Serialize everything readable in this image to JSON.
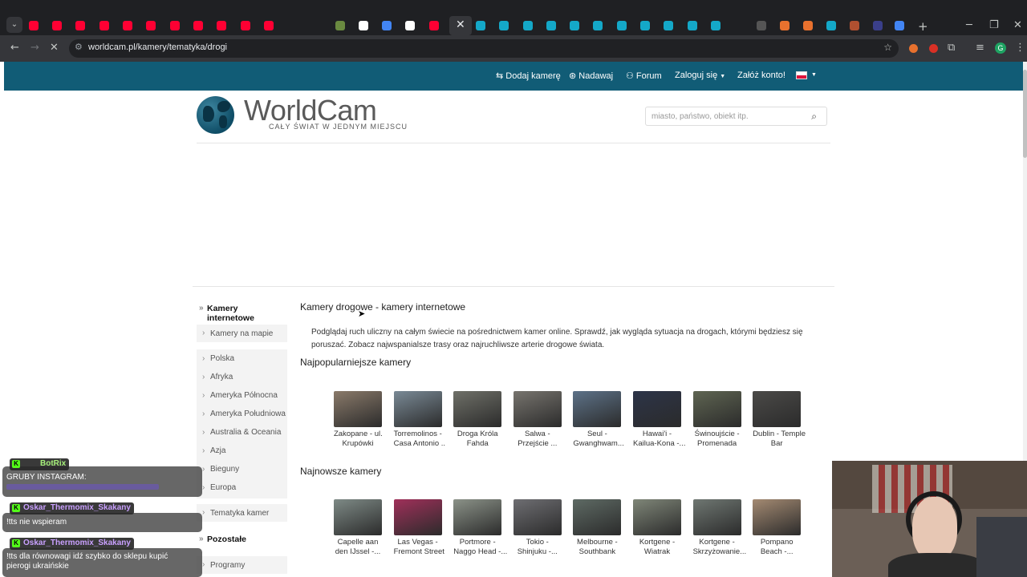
{
  "browser": {
    "url": "worldcam.pl/kamery/tematyka/drogi"
  },
  "nav": {
    "items": [
      {
        "label": "Dodaj kamerę"
      },
      {
        "label": "Nadawaj"
      },
      {
        "label": "Forum"
      },
      {
        "label": "Zaloguj się"
      },
      {
        "label": "Załóż konto!"
      }
    ]
  },
  "header": {
    "logo_text": "WorldCam",
    "logo_tagline": "CAŁY ŚWIAT W JEDNYM MIEJSCU",
    "search_placeholder": "miasto, państwo, obiekt itp."
  },
  "sidebar": {
    "items": [
      {
        "label": "Kamery internetowe"
      },
      {
        "label": "Kamery na mapie"
      },
      {
        "label": "Polska"
      },
      {
        "label": "Afryka"
      },
      {
        "label": "Ameryka Północna"
      },
      {
        "label": "Ameryka Południowa"
      },
      {
        "label": "Australia & Oceania"
      },
      {
        "label": "Azja"
      },
      {
        "label": "Bieguny"
      },
      {
        "label": "Europa"
      },
      {
        "label": "Tematyka kamer"
      },
      {
        "label": "Pozostałe"
      },
      {
        "label": "Programy"
      }
    ]
  },
  "main": {
    "title": "Kamery drogowe - kamery internetowe",
    "intro": "Podglądaj ruch uliczny na całym świecie na pośrednictwem kamer online. Sprawdź, jak wygląda sytuacja na drogach, którymi będziesz się poruszać. Zobacz najwspanialsze trasy oraz najruchliwsze arterie drogowe świata.",
    "popular_heading": "Najpopularniejsze kamery",
    "popular": [
      {
        "line1": "Zakopane - ul.",
        "line2": "Krupówki",
        "color": "#8a7a6a"
      },
      {
        "line1": "Torremolinos -",
        "line2": "Casa Antonio ..",
        "color": "#7a8a96"
      },
      {
        "line1": "Droga Króla",
        "line2": "Fahda",
        "color": "#6f7068"
      },
      {
        "line1": "Salwa -",
        "line2": "Przejście ...",
        "color": "#77746e"
      },
      {
        "line1": "Seul -",
        "line2": "Gwanghwam...",
        "color": "#5d7288"
      },
      {
        "line1": "Hawai'i -",
        "line2": "Kailua-Kona -...",
        "color": "#2c3448"
      },
      {
        "line1": "Świnoujście -",
        "line2": "Promenada",
        "color": "#5f6552"
      },
      {
        "line1": "Dublin - Temple",
        "line2": "Bar",
        "color": "#4b4a48"
      }
    ],
    "newest_heading": "Najnowsze kamery",
    "newest": [
      {
        "line1": "Capelle aan",
        "line2": "den IJssel -...",
        "color": "#7e8a86"
      },
      {
        "line1": "Las Vegas -",
        "line2": "Fremont Street",
        "color": "#a0305a"
      },
      {
        "line1": "Portmore -",
        "line2": "Naggo Head -...",
        "color": "#8b9288"
      },
      {
        "line1": "Tokio -",
        "line2": "Shinjuku -...",
        "color": "#6e6e72"
      },
      {
        "line1": "Melbourne -",
        "line2": "Southbank",
        "color": "#5e6a64"
      },
      {
        "line1": "Kortgene -",
        "line2": "Wiatrak",
        "color": "#7f8678"
      },
      {
        "line1": "Kortgene -",
        "line2": "Skrzyżowanie...",
        "color": "#6f7772"
      },
      {
        "line1": "Pompano",
        "line2": "Beach -...",
        "color": "#a48a72"
      }
    ]
  },
  "chat": {
    "bot_name": "BotRix",
    "bot_line1": "GRUBY INSTAGRAM:",
    "messages": [
      {
        "user": "Oskar_Thermomix_Skakany",
        "text": "!tts nie wspieram"
      },
      {
        "user": "Oskar_Thermomix_Skakany",
        "text": "!tts dla równowagi idź szybko do sklepu kupić pierogi ukraińskie"
      }
    ]
  }
}
